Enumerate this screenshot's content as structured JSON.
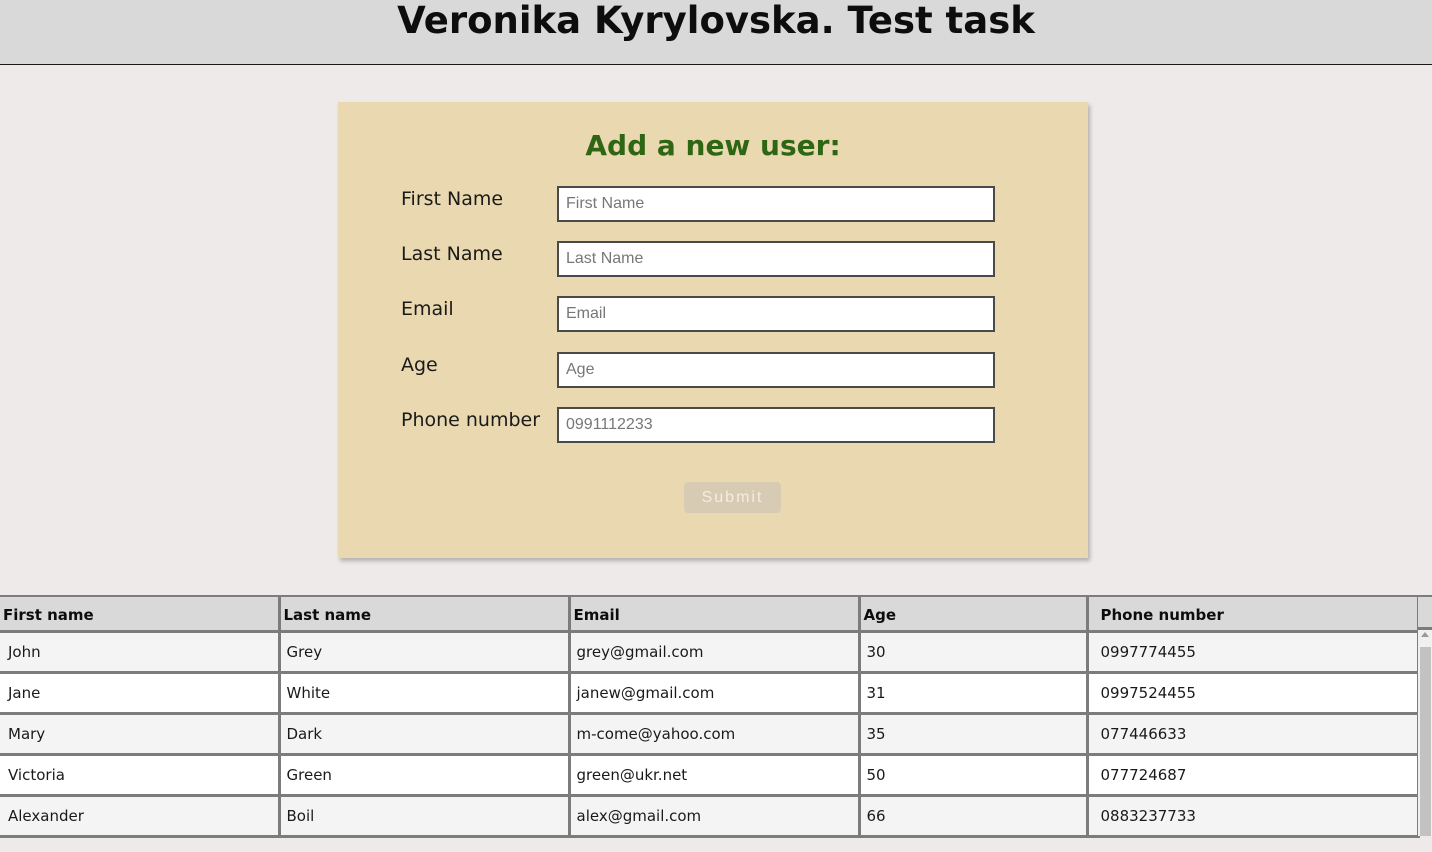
{
  "header": {
    "title": "Veronika Kyrylovska. Test task"
  },
  "form": {
    "title": "Add a new user:",
    "fields": [
      {
        "label": "First Name",
        "placeholder": "First Name",
        "value": ""
      },
      {
        "label": "Last Name",
        "placeholder": "Last Name",
        "value": ""
      },
      {
        "label": "Email",
        "placeholder": "Email",
        "value": ""
      },
      {
        "label": "Age",
        "placeholder": "Age",
        "value": ""
      },
      {
        "label": "Phone number",
        "placeholder": "0991112233",
        "value": ""
      }
    ],
    "submit_label": "Submit"
  },
  "table": {
    "headers": [
      "First name",
      "Last name",
      "Email",
      "Age",
      "Phone number"
    ],
    "rows": [
      [
        "John",
        "Grey",
        "grey@gmail.com",
        "30",
        "0997774455"
      ],
      [
        "Jane",
        "White",
        "janew@gmail.com",
        "31",
        "0997524455"
      ],
      [
        "Mary",
        "Dark",
        "m-come@yahoo.com",
        "35",
        "077446633"
      ],
      [
        "Victoria",
        "Green",
        "green@ukr.net",
        "50",
        "077724687"
      ],
      [
        "Alexander",
        "Boil",
        "alex@gmail.com",
        "66",
        "0883237733"
      ]
    ]
  },
  "colors": {
    "header_bg": "#d9d9d9",
    "form_bg": "#ead9b0",
    "form_title": "#2e6614",
    "submit_disabled": "#d8cbb3"
  }
}
